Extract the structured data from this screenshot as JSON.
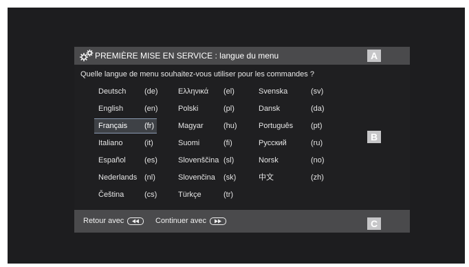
{
  "dialog": {
    "title": "PREMIÈRE MISE EN SERVICE : langue du menu",
    "question": "Quelle langue de menu souhaitez-vous utiliser pour les commandes ?",
    "markers": {
      "a": "A",
      "b": "B",
      "c": "C"
    },
    "columns": [
      [
        {
          "name": "Deutsch",
          "code": "(de)"
        },
        {
          "name": "English",
          "code": "(en)"
        },
        {
          "name": "Français",
          "code": "(fr)",
          "selected": true
        },
        {
          "name": "Italiano",
          "code": "(it)"
        },
        {
          "name": "Español",
          "code": "(es)"
        },
        {
          "name": "Nederlands",
          "code": "(nl)"
        },
        {
          "name": "Čeština",
          "code": "(cs)"
        }
      ],
      [
        {
          "name": "Ελληνικά",
          "code": "(el)"
        },
        {
          "name": "Polski",
          "code": "(pl)"
        },
        {
          "name": "Magyar",
          "code": "(hu)"
        },
        {
          "name": "Suomi",
          "code": "(fi)"
        },
        {
          "name": "Slovenščina",
          "code": "(sl)"
        },
        {
          "name": "Slovenčina",
          "code": "(sk)"
        },
        {
          "name": "Türkçe",
          "code": "(tr)"
        }
      ],
      [
        {
          "name": "Svenska",
          "code": "(sv)"
        },
        {
          "name": "Dansk",
          "code": "(da)"
        },
        {
          "name": "Português",
          "code": "(pt)"
        },
        {
          "name": "Русский",
          "code": "(ru)"
        },
        {
          "name": "Norsk",
          "code": "(no)"
        },
        {
          "name": "中文",
          "code": "(zh)"
        }
      ]
    ],
    "footer": {
      "back_label": "Retour avec",
      "continue_label": "Continuer avec",
      "back_icon": "rewind-button-icon",
      "continue_icon": "fast-forward-button-icon"
    }
  },
  "colors": {
    "screen_bg": "#1d1d1f",
    "panel_bg": "#4a4a4c",
    "content_bg": "#1f1f21",
    "selection_bg": "#3e4146",
    "selection_border": "#8a9ab2",
    "marker_bg": "#c6c6c8"
  }
}
